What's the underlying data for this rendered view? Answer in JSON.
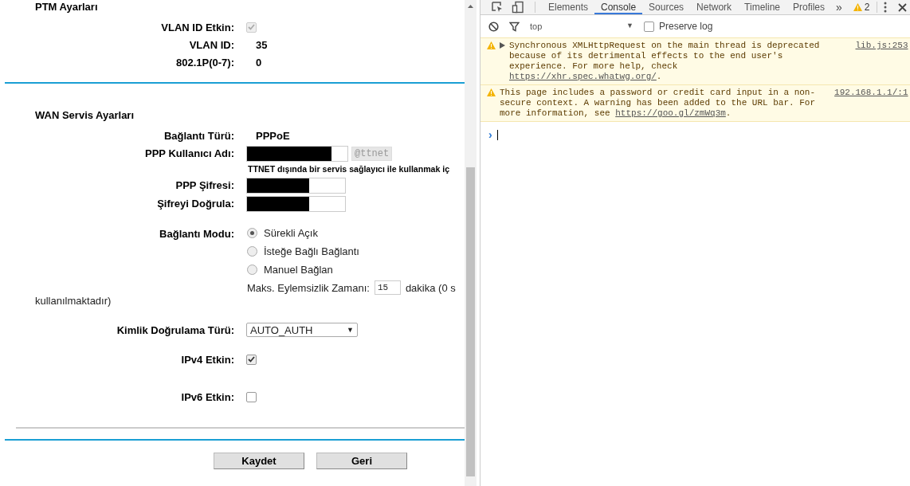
{
  "router_page": {
    "ptm": {
      "title": "PTM Ayarları",
      "rows": [
        {
          "kind": "checkbox",
          "label": "VLAN ID Etkin:",
          "checked": true,
          "disabled": true
        },
        {
          "kind": "text",
          "label": "VLAN ID:",
          "value": "35"
        },
        {
          "kind": "text",
          "label": "802.1P(0-7):",
          "value": "0"
        }
      ]
    },
    "wan": {
      "title": "WAN Servis Ayarları",
      "rows": [
        {
          "kind": "text",
          "label": "Bağlantı Türü:",
          "value": "PPPoE"
        },
        {
          "kind": "redacted",
          "label": "PPP Kullanıcı Adı:",
          "suffix": "@ttnet"
        },
        {
          "kind": "note",
          "text": "TTNET dışında bir servis sağlayıcı ile kullanmak iç"
        },
        {
          "kind": "redacted",
          "label": "PPP Şifresi:"
        },
        {
          "kind": "redacted",
          "label": "Şifreyi Doğrula:"
        },
        {
          "kind": "radio",
          "label": "Bağlantı Modu:",
          "options": [
            {
              "label": "Sürekli Açık",
              "selected": true
            },
            {
              "label": "İsteğe Bağlı Bağlantı",
              "selected": false
            },
            {
              "label": "Manuel Bağlan",
              "selected": false
            }
          ]
        },
        {
          "kind": "idle",
          "label": "Maks. Eylemsizlik Zamanı:",
          "value": "15",
          "unit": "dakika (0 s",
          "wrap": "kullanılmaktadır)"
        },
        {
          "kind": "select",
          "label": "Kimlik Doğrulama Türü:",
          "value": "AUTO_AUTH",
          "caret": "▼"
        },
        {
          "kind": "checkbox",
          "label": "IPv4 Etkin:",
          "checked": true,
          "disabled": false
        },
        {
          "kind": "checkbox",
          "label": "IPv6 Etkin:",
          "checked": false,
          "disabled": false
        }
      ]
    },
    "buttons": [
      "Kaydet",
      "Geri"
    ]
  },
  "devtools": {
    "tabs": [
      {
        "label": "Elements",
        "selected": false
      },
      {
        "label": "Console",
        "selected": true
      },
      {
        "label": "Sources",
        "selected": false
      },
      {
        "label": "Network",
        "selected": false
      },
      {
        "label": "Timeline",
        "selected": false
      },
      {
        "label": "Profiles",
        "selected": false
      }
    ],
    "more": "»",
    "warning_count": "2",
    "context": "top",
    "context_caret": "▼",
    "preserve_log": {
      "label": "Preserve log",
      "checked": false
    },
    "messages": [
      {
        "kind": "warning",
        "expandable": true,
        "source": "lib.js:253",
        "parts": [
          {
            "text": "Synchronous XMLHttpRequest on the main thread is deprecated because of its detrimental effects to the end user's experience. For more help, check "
          },
          {
            "link": "https://xhr.spec.whatwg.org/"
          },
          {
            "text": "."
          }
        ]
      },
      {
        "kind": "warning",
        "expandable": false,
        "source": "192.168.1.1/:1",
        "parts": [
          {
            "text": "This page includes a password or credit card input in a non-secure context. A warning has been added to the URL bar. For more information, see "
          },
          {
            "link": "https://goo.gl/zmWq3m"
          },
          {
            "text": "."
          }
        ]
      }
    ],
    "prompt": "›"
  }
}
